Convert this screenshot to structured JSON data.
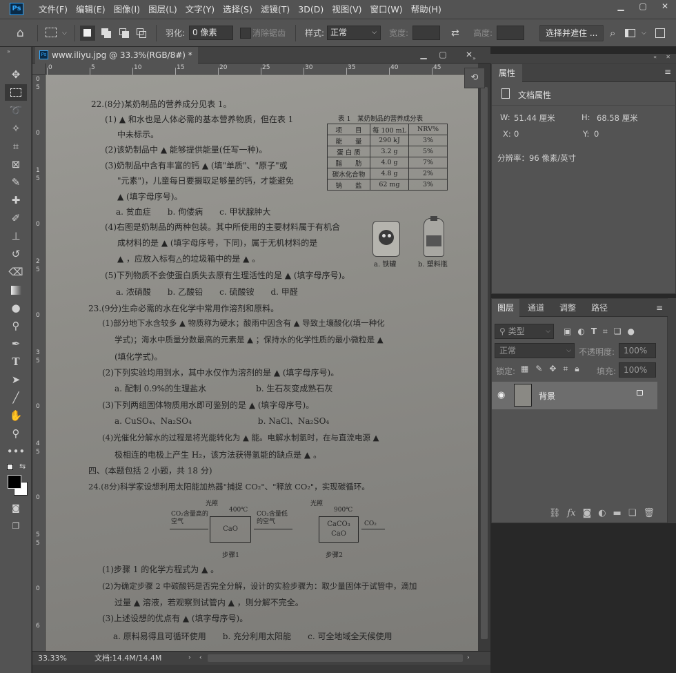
{
  "app": {
    "logo_text": "Ps"
  },
  "menu": [
    "文件(F)",
    "编辑(E)",
    "图像(I)",
    "图层(L)",
    "文字(Y)",
    "选择(S)",
    "滤镜(T)",
    "3D(D)",
    "视图(V)",
    "窗口(W)",
    "帮助(H)"
  ],
  "window_controls": {
    "minimize": "▁",
    "restore": "▢",
    "close": "✕"
  },
  "options": {
    "feather_label": "羽化:",
    "feather_value": "0 像素",
    "antialias_label": "消除锯齿",
    "style_label": "样式:",
    "style_value": "正常",
    "width_label": "宽度:",
    "height_label": "高度:",
    "select_mask_button": "选择并遮住 ..."
  },
  "document": {
    "tab_title": "www.iliyu.jpg @ 33.3%(RGB/8#) *",
    "zoom": "33.33%",
    "doc_size": "文档:14.4M/14.4M"
  },
  "rulers": {
    "h": [
      "0",
      "5",
      "10",
      "15",
      "20",
      "25",
      "30",
      "35",
      "40",
      "45"
    ],
    "v": [
      "0",
      "1",
      "2",
      "3",
      "4",
      "5",
      "6"
    ],
    "v_minor": [
      "5",
      "0",
      "5",
      "0",
      "5",
      "0",
      "5",
      "0",
      "5",
      "0",
      "5",
      "0"
    ]
  },
  "paper": {
    "lines": [
      "22.(8分)某奶制品的营养成分见表 1。",
      "(1) ▲ 和水也是人体必需的基本营养物质，但在表 1",
      "中未标示。",
      "(2)该奶制品中 ▲ 能够提供能量(任写一种)。",
      "(3)奶制品中含有丰富的钙 ▲ (填\"单质\"、\"原子\"或",
      "\"元素\")，儿童每日要摄取足够量的钙，才能避免",
      "▲ (填字母序号)。",
      "a. 贫血症　　b. 佝偻病　　c. 甲状腺肿大",
      "(4)右图是奶制品的两种包装。其中所使用的主要材料属于有机合",
      "成材料的是 ▲ (填字母序号，下同)，属于无机材料的是",
      "▲ ，应放入标有△的垃圾箱中的是 ▲ 。",
      "(5)下列物质不会使蛋白质失去原有生理活性的是 ▲ (填字母序号)。",
      "a. 浓硝酸　　b. 乙酸铅　　c. 硫酸铵　　d. 甲醛",
      "23.(9分)生命必需的水在化学中常用作溶剂和原料。",
      "(1)部分地下水含较多 ▲ 物质称为硬水；酸雨中因含有 ▲ 导致土壤酸化(填一种化",
      "学式)；海水中质量分数最高的元素是 ▲ ；保持水的化学性质的最小微粒是 ▲",
      "(填化学式)。",
      "(2)下列实验均用到水，其中水仅作为溶剂的是 ▲ (填字母序号)。",
      "a. 配制 0.9%的生理盐水　　　　　　b. 生石灰变成熟石灰",
      "(3)下列两组固体物质用水即可鉴别的是 ▲ (填字母序号)。",
      "a. CuSO₄、Na₂SO₄　　　　　　　　b. NaCl、Na₂SO₄",
      "(4)光催化分解水的过程是将光能转化为 ▲ 能。电解水制氢时，在与直流电源 ▲",
      "极相连的电极上产生 H₂，该方法获得氢能的缺点是 ▲ 。",
      "四、(本题包括 2 小题，共 18 分)",
      "24.(8分)科学家设想利用太阳能加热器\"捕捉 CO₂\"、\"释放 CO₂\"，实现碳循环。",
      "(1)步骤 1 的化学方程式为 ▲ 。",
      "(2)为确定步骤 2 中碳酸钙是否完全分解，设计的实验步骤为：取少量固体于试管中，滴加",
      "过量 ▲ 溶液，若观察到试管内 ▲ ，则分解不完全。",
      "(3)上述设想的优点有 ▲ (填字母序号)。",
      "a. 原料易得且可循环使用　　b. 充分利用太阳能　　c. 可全地域全天候使用"
    ],
    "table_title": "表 1　某奶制品的营养成分表",
    "table_headers": [
      "项　　目",
      "每 100 mL",
      "NRV%"
    ],
    "table_rows": [
      [
        "能　　量",
        "290 kJ",
        "3%"
      ],
      [
        "蛋 白 质",
        "3.2 g",
        "5%"
      ],
      [
        "脂　　肪",
        "4.0 g",
        "7%"
      ],
      [
        "碳水化合物",
        "4.8 g",
        "2%"
      ],
      [
        "钠　　盐",
        "62 mg",
        "3%"
      ]
    ],
    "image_captions": [
      "a. 铁罐",
      "b. 塑料瓶"
    ],
    "diagram": {
      "light1": "光照",
      "temp1": "400℃",
      "in1": "CO₂含量高的空气",
      "box1": "CaO",
      "out1": "CO₂含量低的空气",
      "step1": "步骤1",
      "light2": "光照",
      "temp2": "900℃",
      "box2a": "CaCO₃",
      "box2b": "CaO",
      "out2": "CO₂",
      "step2": "步骤2"
    }
  },
  "properties": {
    "tab": "属性",
    "doc_props": "文档属性",
    "w_label": "W:",
    "w_value": "51.44 厘米",
    "h_label": "H:",
    "h_value": "68.58 厘米",
    "x_label": "X:",
    "x_value": "0",
    "y_label": "Y:",
    "y_value": "0",
    "resolution": "分辨率：96 像素/英寸"
  },
  "layers": {
    "tabs": [
      "图层",
      "通道",
      "调整",
      "路径"
    ],
    "kind_filter": "类型",
    "blend_mode": "正常",
    "opacity_label": "不透明度:",
    "opacity_value": "100%",
    "lock_label": "锁定:",
    "fill_label": "填充:",
    "fill_value": "100%",
    "layer_name": "背景"
  }
}
